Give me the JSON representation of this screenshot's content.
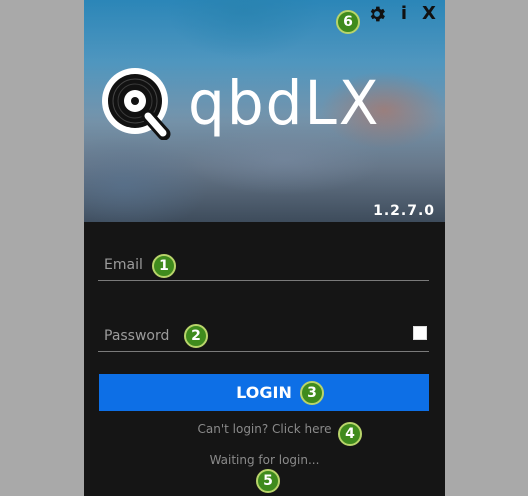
{
  "app": {
    "name": "qbdLX",
    "version": "1.2.7.0"
  },
  "window_controls": {
    "info_label": "i",
    "close_label": "X",
    "settings_icon": "gear-icon"
  },
  "login_form": {
    "email_placeholder": "Email",
    "email_value": "",
    "password_placeholder": "Password",
    "password_value": "",
    "show_password_checked": false,
    "login_label": "LOGIN",
    "help_link": "Can't login? Click here",
    "status": "Waiting for login..."
  },
  "annotations": {
    "m1": "1",
    "m2": "2",
    "m3": "3",
    "m4": "4",
    "m5": "5",
    "m6": "6"
  },
  "colors": {
    "backdrop": "#a9a9a9",
    "form_background": "#151515",
    "login_button": "#0d6fe6",
    "annotation_marker": "#3f8b1d"
  }
}
